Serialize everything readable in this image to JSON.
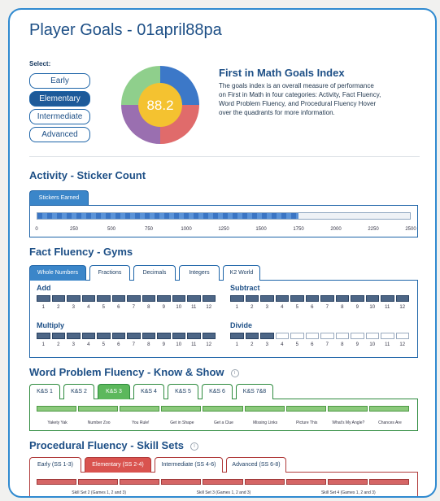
{
  "page": {
    "title": "Player Goals - 01april88pa",
    "select_label": "Select:",
    "levels": [
      "Early",
      "Elementary",
      "Intermediate",
      "Advanced"
    ],
    "active_level": "Elementary"
  },
  "index": {
    "score": "88.2",
    "title": "First in Math Goals Index",
    "description": "The goals index is an overall measure of performance on First in Math in four categories: Activity, Fact Fluency, Word Problem Fluency, and Procedural Fluency Hover over the quadrants for more information.",
    "colors": {
      "center": "#f4c230",
      "top": "#3c78c8",
      "right": "#e06b6b",
      "bottom": "#9a6fb0",
      "left": "#8fcf8c"
    }
  },
  "activity": {
    "title": "Activity - Sticker Count",
    "tab": "Stickers Earned",
    "stickers_earned": 1750,
    "axis_ticks": [
      "0",
      "250",
      "500",
      "750",
      "1000",
      "1250",
      "1500",
      "1750",
      "2000",
      "2250",
      "2500"
    ],
    "axis_max": 2500
  },
  "fact": {
    "title": "Fact Fluency - Gyms",
    "tabs": [
      "Whole Numbers",
      "Fractions",
      "Decimals",
      "Integers",
      "K2 World"
    ],
    "active_tab": "Whole Numbers",
    "gyms": [
      {
        "name": "Add",
        "completed": 12
      },
      {
        "name": "Subtract",
        "completed": 12
      },
      {
        "name": "Multiply",
        "completed": 12
      },
      {
        "name": "Divide",
        "completed": 3
      }
    ],
    "levels": [
      "1",
      "2",
      "3",
      "4",
      "5",
      "6",
      "7",
      "8",
      "9",
      "10",
      "11",
      "12"
    ]
  },
  "word": {
    "title": "Word Problem Fluency - Know & Show",
    "info_icon": "i",
    "tabs": [
      "K&S 1",
      "K&S 2",
      "K&S 3",
      "K&S 4",
      "K&S 5",
      "K&S 6",
      "K&S 7&8"
    ],
    "active_tab": "K&S 3",
    "items": [
      "Yakety Yak",
      "Number Zoo",
      "You Rule!",
      "Get in Shape",
      "Get a Clue",
      "Missing Links",
      "Picture This",
      "What's My Angle?",
      "Chances Are"
    ],
    "completed": 9
  },
  "proc": {
    "title": "Procedural Fluency - Skill Sets",
    "info_icon": "i",
    "tabs": [
      "Early (SS 1-3)",
      "Elementary (SS 2-4)",
      "Intermediate (SS 4-6)",
      "Advanced (SS 6-8)"
    ],
    "active_tab": "Elementary (SS 2-4)",
    "sets": [
      "Skill Set 2 (Games 1, 2 and 3)",
      "Skill Set 3 (Games 1, 2 and 3)",
      "Skill Set 4 (Games 1, 2 and 3)"
    ],
    "completed": 9
  }
}
